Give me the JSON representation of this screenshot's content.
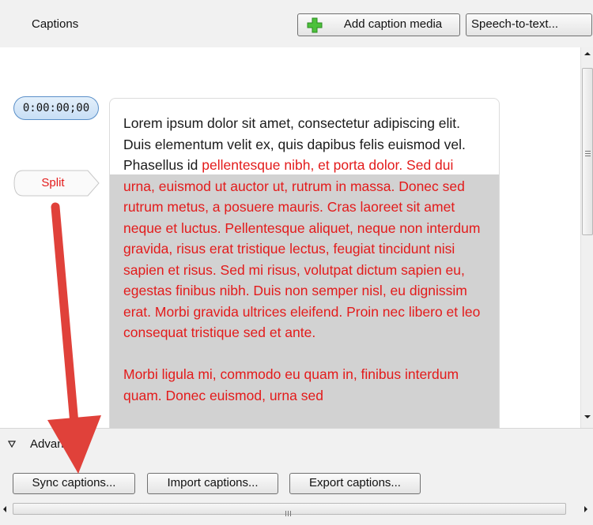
{
  "panel": {
    "title": "Captions"
  },
  "toolbar": {
    "add_caption_media_label": "Add caption media",
    "speech_to_text_label": "Speech-to-text...",
    "add_icon": "plus-icon"
  },
  "caption": {
    "timestamp": "0:00:00;00",
    "split_label": "Split",
    "text_before_cursor": "Lorem ipsum dolor sit amet, consectetur adipiscing elit. Duis elementum velit ex, quis dapibus felis euismod vel. Phasellus id",
    "text_after_cursor": "pellentesque nibh, et porta dolor. Sed dui urna, euismod ut auctor ut, rutrum in massa. Donec sed rutrum metus, a posuere mauris. Cras laoreet sit amet neque et luctus. Pellentesque aliquet, neque non interdum gravida, risus erat tristique lectus, feugiat tincidunt nisi sapien et risus. Sed mi risus, volutpat dictum sapien eu, egestas finibus nibh. Duis non semper nisl, eu dignissim erat. Morbi gravida ultrices eleifend. Proin nec libero et leo consequat tristique sed et ante.",
    "text_paragraph_2": "Morbi ligula mi, commodo eu quam in, finibus interdum quam. Donec euismod, urna sed"
  },
  "advanced": {
    "label": "Advanced",
    "sync_label": "Sync captions...",
    "import_label": "Import captions...",
    "export_label": "Export captions..."
  },
  "colors": {
    "selected_text": "#e31b1b",
    "annotation_arrow": "#e0413a",
    "timestamp_pill": "#c7def5"
  }
}
